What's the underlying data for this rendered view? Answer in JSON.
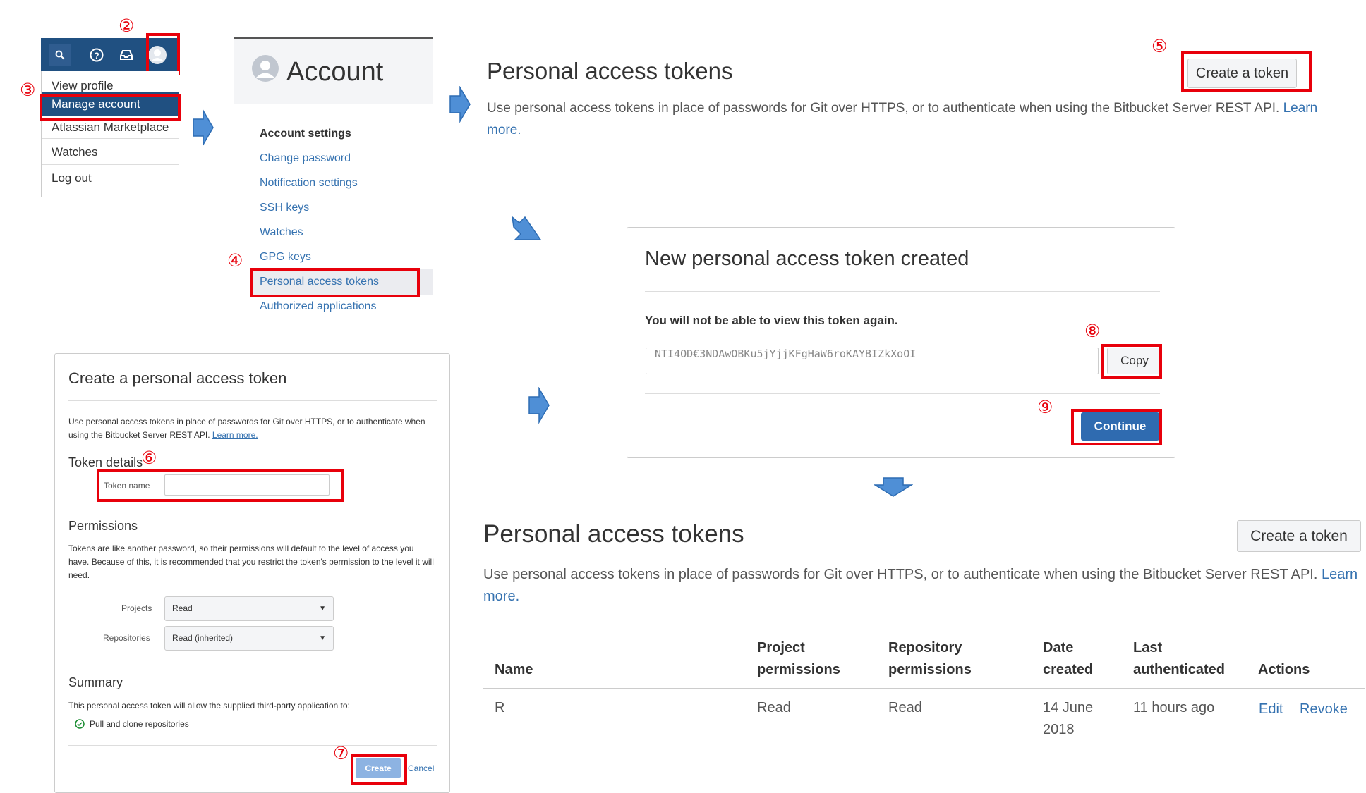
{
  "user_menu": {
    "items": [
      "View profile",
      "Manage account",
      "Atlassian Marketplace",
      "Watches",
      "Log out"
    ],
    "search_icon": "search-icon",
    "help_icon": "help-icon",
    "inbox_icon": "inbox-icon",
    "avatar_icon": "avatar-icon"
  },
  "account": {
    "title": "Account",
    "section": "Account settings",
    "nav": [
      "Change password",
      "Notification settings",
      "SSH keys",
      "Watches",
      "GPG keys",
      "Personal access tokens",
      "Authorized applications"
    ]
  },
  "tokens_page": {
    "title": "Personal access tokens",
    "create_button": "Create a token",
    "desc": "Use personal access tokens in place of passwords for Git over HTTPS, or to authenticate when using the Bitbucket Server REST API.",
    "learn_more": "Learn more."
  },
  "create_form": {
    "title": "Create a personal access token",
    "desc": "Use personal access tokens in place of passwords for Git over HTTPS, or to authenticate when using the Bitbucket Server REST API.",
    "learn_more": "Learn more.",
    "token_details": "Token details",
    "token_name_label": "Token name",
    "token_name_value": "",
    "permissions": "Permissions",
    "permissions_desc": "Tokens are like another password, so their permissions will default to the level of access you have. Because of this, it is recommended that you restrict the token's permission to the level it will need.",
    "projects_label": "Projects",
    "projects_value": "Read",
    "repos_label": "Repositories",
    "repos_value": "Read (inherited)",
    "summary": "Summary",
    "summary_desc": "This personal access token will allow the supplied third-party application to:",
    "summary_item": "Pull and clone repositories",
    "create_button": "Create",
    "cancel": "Cancel"
  },
  "created_dialog": {
    "title": "New personal access token created",
    "warning": "You will not be able to view this token again.",
    "token_value": "NTI4OD€3NDAwOBKu5jYjjKFgHaW6roKAYBIZkXoOI",
    "copy_button": "Copy",
    "continue_button": "Continue"
  },
  "result_page": {
    "title": "Personal access tokens",
    "create_button": "Create a token",
    "desc": "Use personal access tokens in place of passwords for Git over HTTPS, or to authenticate when using the Bitbucket Server REST API.",
    "learn_more": "Learn more.",
    "columns": [
      "Name",
      "Project",
      "permissions",
      "Repository",
      "permissions",
      "Date",
      "created",
      "Last",
      "authenticated",
      "Actions"
    ],
    "row": {
      "name": "R",
      "project": "Read",
      "repository": "Read",
      "date_1": "14 June",
      "date_2": "2018",
      "last": "11 hours ago",
      "edit": "Edit",
      "revoke": "Revoke"
    }
  },
  "step_numbers": [
    "②",
    "③",
    "④",
    "⑤",
    "⑥",
    "⑦",
    "⑧",
    "⑨"
  ],
  "colors": {
    "annotation": "#e8000b",
    "header": "#205081",
    "primary": "#3572b0",
    "arrow": "#4f8fd6"
  }
}
